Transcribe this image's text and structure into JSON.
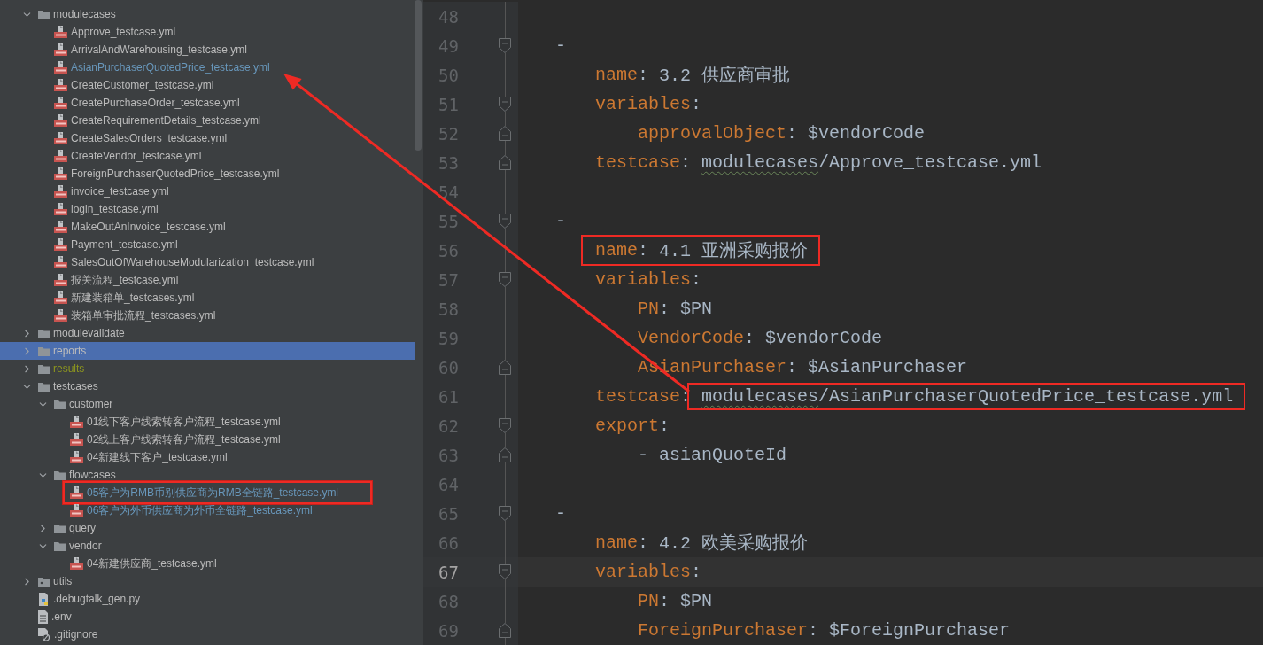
{
  "project_tree": {
    "items": [
      {
        "label": "modulecases",
        "kind": "folder",
        "expanded": true,
        "selected": false,
        "modified": false,
        "ignored": false,
        "boxed": false,
        "children": [
          {
            "label": "Approve_testcase.yml",
            "kind": "yml",
            "selected": false,
            "modified": false,
            "ignored": false,
            "boxed": false
          },
          {
            "label": "ArrivalAndWarehousing_testcase.yml",
            "kind": "yml",
            "selected": false,
            "modified": false,
            "ignored": false,
            "boxed": false
          },
          {
            "label": "AsianPurchaserQuotedPrice_testcase.yml",
            "kind": "yml",
            "selected": false,
            "modified": true,
            "ignored": false,
            "boxed": false
          },
          {
            "label": "CreateCustomer_testcase.yml",
            "kind": "yml",
            "selected": false,
            "modified": false,
            "ignored": false,
            "boxed": false
          },
          {
            "label": "CreatePurchaseOrder_testcase.yml",
            "kind": "yml",
            "selected": false,
            "modified": false,
            "ignored": false,
            "boxed": false
          },
          {
            "label": "CreateRequirementDetails_testcase.yml",
            "kind": "yml",
            "selected": false,
            "modified": false,
            "ignored": false,
            "boxed": false
          },
          {
            "label": "CreateSalesOrders_testcase.yml",
            "kind": "yml",
            "selected": false,
            "modified": false,
            "ignored": false,
            "boxed": false
          },
          {
            "label": "CreateVendor_testcase.yml",
            "kind": "yml",
            "selected": false,
            "modified": false,
            "ignored": false,
            "boxed": false
          },
          {
            "label": "ForeignPurchaserQuotedPrice_testcase.yml",
            "kind": "yml",
            "selected": false,
            "modified": false,
            "ignored": false,
            "boxed": false
          },
          {
            "label": "invoice_testcase.yml",
            "kind": "yml",
            "selected": false,
            "modified": false,
            "ignored": false,
            "boxed": false
          },
          {
            "label": "login_testcase.yml",
            "kind": "yml",
            "selected": false,
            "modified": false,
            "ignored": false,
            "boxed": false
          },
          {
            "label": "MakeOutAnInvoice_testcase.yml",
            "kind": "yml",
            "selected": false,
            "modified": false,
            "ignored": false,
            "boxed": false
          },
          {
            "label": "Payment_testcase.yml",
            "kind": "yml",
            "selected": false,
            "modified": false,
            "ignored": false,
            "boxed": false
          },
          {
            "label": "SalesOutOfWarehouseModularization_testcase.yml",
            "kind": "yml",
            "selected": false,
            "modified": false,
            "ignored": false,
            "boxed": false
          },
          {
            "label": "报关流程_testcase.yml",
            "kind": "yml",
            "selected": false,
            "modified": false,
            "ignored": false,
            "boxed": false
          },
          {
            "label": "新建装箱单_testcases.yml",
            "kind": "yml",
            "selected": false,
            "modified": false,
            "ignored": false,
            "boxed": false
          },
          {
            "label": "装箱单审批流程_testcases.yml",
            "kind": "yml",
            "selected": false,
            "modified": false,
            "ignored": false,
            "boxed": false
          }
        ]
      },
      {
        "label": "modulevalidate",
        "kind": "folder",
        "expanded": false,
        "selected": false,
        "modified": false,
        "ignored": false,
        "boxed": false
      },
      {
        "label": "reports",
        "kind": "folder",
        "expanded": false,
        "selected": true,
        "modified": false,
        "ignored": false,
        "boxed": false
      },
      {
        "label": "results",
        "kind": "folder",
        "expanded": false,
        "selected": false,
        "modified": false,
        "ignored": true,
        "boxed": false
      },
      {
        "label": "testcases",
        "kind": "folder",
        "expanded": true,
        "selected": false,
        "modified": false,
        "ignored": false,
        "boxed": false,
        "children": [
          {
            "label": "customer",
            "kind": "folder",
            "expanded": true,
            "selected": false,
            "modified": false,
            "ignored": false,
            "boxed": false,
            "children": [
              {
                "label": "01线下客户线索转客户流程_testcase.yml",
                "kind": "yml",
                "selected": false,
                "modified": false,
                "ignored": false,
                "boxed": false
              },
              {
                "label": "02线上客户线索转客户流程_testcase.yml",
                "kind": "yml",
                "selected": false,
                "modified": false,
                "ignored": false,
                "boxed": false
              },
              {
                "label": "04新建线下客户_testcase.yml",
                "kind": "yml",
                "selected": false,
                "modified": false,
                "ignored": false,
                "boxed": false
              }
            ]
          },
          {
            "label": "flowcases",
            "kind": "folder",
            "expanded": true,
            "selected": false,
            "modified": false,
            "ignored": false,
            "boxed": false,
            "children": [
              {
                "label": "05客户为RMB币别供应商为RMB全链路_testcase.yml",
                "kind": "yml",
                "selected": false,
                "modified": true,
                "ignored": false,
                "boxed": true
              },
              {
                "label": "06客户为外币供应商为外币全链路_testcase.yml",
                "kind": "yml",
                "selected": false,
                "modified": true,
                "ignored": false,
                "boxed": false
              }
            ]
          },
          {
            "label": "query",
            "kind": "folder",
            "expanded": false,
            "selected": false,
            "modified": false,
            "ignored": false,
            "boxed": false
          },
          {
            "label": "vendor",
            "kind": "folder",
            "expanded": true,
            "selected": false,
            "modified": false,
            "ignored": false,
            "boxed": false,
            "children": [
              {
                "label": "04新建供应商_testcase.yml",
                "kind": "yml",
                "selected": false,
                "modified": false,
                "ignored": false,
                "boxed": false
              }
            ]
          }
        ]
      },
      {
        "label": "utils",
        "kind": "package",
        "expanded": false,
        "selected": false,
        "modified": false,
        "ignored": false,
        "boxed": false
      },
      {
        "label": ".debugtalk_gen.py",
        "kind": "py",
        "selected": false,
        "modified": false,
        "ignored": false,
        "boxed": false
      },
      {
        "label": ".env",
        "kind": "text",
        "selected": false,
        "modified": false,
        "ignored": false,
        "boxed": false
      },
      {
        "label": ".gitignore",
        "kind": "ignore",
        "selected": false,
        "modified": false,
        "ignored": false,
        "boxed": false
      }
    ]
  },
  "editor": {
    "lines": [
      {
        "number": "48",
        "kind": "blank",
        "current": false,
        "fold_start": false,
        "fold_end": false
      },
      {
        "number": "49",
        "kind": "dash",
        "current": false,
        "fold_start": true,
        "fold_end": false,
        "tokens": [
          {
            "kind": "punct",
            "text": "-"
          }
        ]
      },
      {
        "number": "50",
        "kind": "field",
        "current": false,
        "fold_start": false,
        "fold_end": false,
        "tokens": [
          {
            "kind": "key",
            "text": "name"
          },
          {
            "kind": "punct",
            "text": ":"
          },
          {
            "kind": "value",
            "text": "3.2 供应商审批"
          }
        ]
      },
      {
        "number": "51",
        "kind": "field",
        "current": false,
        "fold_start": true,
        "fold_end": false,
        "tokens": [
          {
            "kind": "key",
            "text": "variables"
          },
          {
            "kind": "punct",
            "text": ":"
          }
        ]
      },
      {
        "number": "52",
        "kind": "subfield",
        "current": false,
        "fold_start": false,
        "fold_end": true,
        "tokens": [
          {
            "kind": "key",
            "text": "approvalObject"
          },
          {
            "kind": "punct",
            "text": ":"
          },
          {
            "kind": "value",
            "text": "$vendorCode"
          }
        ]
      },
      {
        "number": "53",
        "kind": "field",
        "current": false,
        "fold_start": false,
        "fold_end": true,
        "tokens": [
          {
            "kind": "key",
            "text": "testcase"
          },
          {
            "kind": "punct",
            "text": ":"
          },
          {
            "kind": "path",
            "text": "modulecases",
            "warning": true
          },
          {
            "kind": "path",
            "text": "/Approve_testcase.yml"
          }
        ]
      },
      {
        "number": "54",
        "kind": "blank",
        "current": false,
        "fold_start": false,
        "fold_end": false
      },
      {
        "number": "55",
        "kind": "dash",
        "current": false,
        "fold_start": true,
        "fold_end": false,
        "tokens": [
          {
            "kind": "punct",
            "text": "-"
          }
        ]
      },
      {
        "number": "56",
        "kind": "field",
        "current": false,
        "fold_start": false,
        "fold_end": false,
        "tokens": [
          {
            "kind": "key",
            "text": "name",
            "boxed": true
          },
          {
            "kind": "punct",
            "text": ":",
            "boxed": true
          },
          {
            "kind": "value",
            "text": "4.1 亚洲采购报价",
            "boxed": true
          }
        ]
      },
      {
        "number": "57",
        "kind": "field",
        "current": false,
        "fold_start": true,
        "fold_end": false,
        "tokens": [
          {
            "kind": "key",
            "text": "variables"
          },
          {
            "kind": "punct",
            "text": ":"
          }
        ]
      },
      {
        "number": "58",
        "kind": "subfield",
        "current": false,
        "fold_start": false,
        "fold_end": false,
        "tokens": [
          {
            "kind": "key",
            "text": "PN"
          },
          {
            "kind": "punct",
            "text": ":"
          },
          {
            "kind": "value",
            "text": "$PN"
          }
        ]
      },
      {
        "number": "59",
        "kind": "subfield",
        "current": false,
        "fold_start": false,
        "fold_end": false,
        "tokens": [
          {
            "kind": "key",
            "text": "VendorCode"
          },
          {
            "kind": "punct",
            "text": ":"
          },
          {
            "kind": "value",
            "text": "$vendorCode"
          }
        ]
      },
      {
        "number": "60",
        "kind": "subfield",
        "current": false,
        "fold_start": false,
        "fold_end": true,
        "tokens": [
          {
            "kind": "key",
            "text": "AsianPurchaser"
          },
          {
            "kind": "punct",
            "text": ":"
          },
          {
            "kind": "value",
            "text": "$AsianPurchaser"
          }
        ]
      },
      {
        "number": "61",
        "kind": "field",
        "current": false,
        "fold_start": false,
        "fold_end": false,
        "tokens": [
          {
            "kind": "key",
            "text": "testcase"
          },
          {
            "kind": "punct",
            "text": ":"
          },
          {
            "kind": "path",
            "text": "modulecases",
            "warning": true,
            "boxed": true
          },
          {
            "kind": "path",
            "text": "/AsianPurchaserQuotedPrice_testcase.yml",
            "boxed": true
          }
        ]
      },
      {
        "number": "62",
        "kind": "field",
        "current": false,
        "fold_start": true,
        "fold_end": false,
        "tokens": [
          {
            "kind": "key",
            "text": "export"
          },
          {
            "kind": "punct",
            "text": ":"
          }
        ]
      },
      {
        "number": "63",
        "kind": "subfield",
        "current": false,
        "fold_start": false,
        "fold_end": true,
        "tokens": [
          {
            "kind": "value",
            "text": "- asianQuoteId"
          }
        ]
      },
      {
        "number": "64",
        "kind": "blank",
        "current": false,
        "fold_start": false,
        "fold_end": false
      },
      {
        "number": "65",
        "kind": "dash",
        "current": false,
        "fold_start": true,
        "fold_end": false,
        "tokens": [
          {
            "kind": "punct",
            "text": "-"
          }
        ]
      },
      {
        "number": "66",
        "kind": "field",
        "current": false,
        "fold_start": false,
        "fold_end": false,
        "tokens": [
          {
            "kind": "key",
            "text": "name"
          },
          {
            "kind": "punct",
            "text": ":"
          },
          {
            "kind": "value",
            "text": "4.2 欧美采购报价"
          }
        ]
      },
      {
        "number": "67",
        "kind": "field",
        "current": true,
        "fold_start": true,
        "fold_end": false,
        "tokens": [
          {
            "kind": "key",
            "text": "variables"
          },
          {
            "kind": "punct",
            "text": ":"
          }
        ]
      },
      {
        "number": "68",
        "kind": "subfield",
        "current": false,
        "fold_start": false,
        "fold_end": false,
        "tokens": [
          {
            "kind": "key",
            "text": "PN"
          },
          {
            "kind": "punct",
            "text": ":"
          },
          {
            "kind": "value",
            "text": "$PN"
          }
        ]
      },
      {
        "number": "69",
        "kind": "subfield",
        "current": false,
        "fold_start": false,
        "fold_end": true,
        "tokens": [
          {
            "kind": "key",
            "text": "ForeignPurchaser"
          },
          {
            "kind": "punct",
            "text": ":"
          },
          {
            "kind": "value",
            "text": "$ForeignPurchaser"
          }
        ]
      }
    ]
  }
}
